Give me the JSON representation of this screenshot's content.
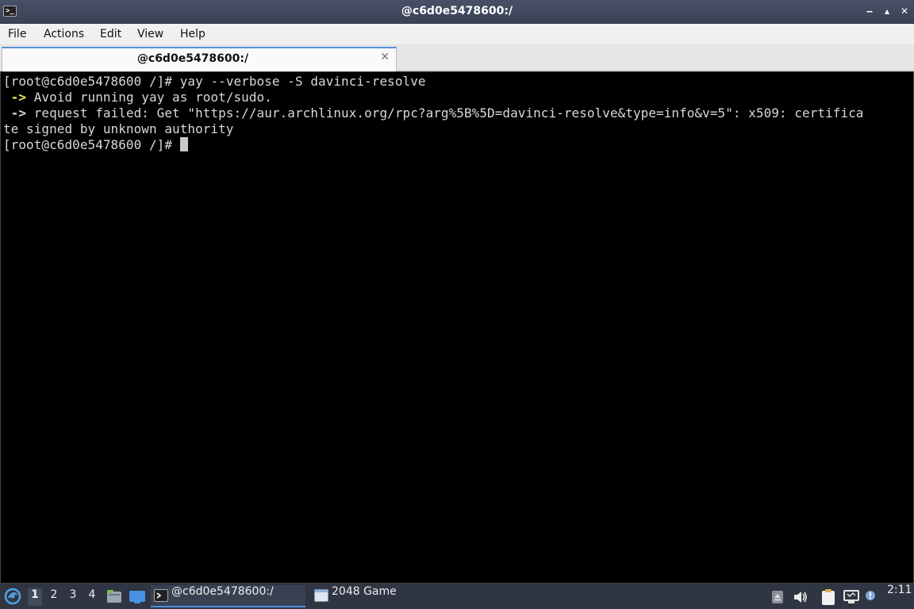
{
  "window": {
    "title": "@c6d0e5478600:/",
    "app_icon": "terminal-icon",
    "buttons": {
      "minimize": "‒",
      "maximize": "▴",
      "close": "✕"
    }
  },
  "menubar": {
    "items": [
      "File",
      "Actions",
      "Edit",
      "View",
      "Help"
    ]
  },
  "tab": {
    "label": "@c6d0e5478600:/",
    "close": "✕"
  },
  "terminal": {
    "lines": [
      {
        "prompt": "[root@c6d0e5478600 /]# ",
        "text": "yay --verbose -S davinci-resolve"
      },
      {
        "arrow": " ->",
        "text": " Avoid running yay as root/sudo."
      },
      {
        "arrow": " ->",
        "text": " request failed: Get \"https://aur.archlinux.org/rpc?arg%5B%5D=davinci-resolve&type=info&v=5\": x509: certifica"
      },
      {
        "text": "te signed by unknown authority"
      },
      {
        "prompt": "[root@c6d0e5478600 /]# ",
        "text": ""
      }
    ]
  },
  "taskbar": {
    "start_icon": "lxqt-start-icon",
    "desktops": [
      "1",
      "2",
      "3",
      "4"
    ],
    "active_desktop": "1",
    "quicklaunch": [
      "file-manager-icon",
      "desktop-icon"
    ],
    "tasks": [
      {
        "icon": "terminal-icon",
        "label": "@c6d0e5478600:/",
        "active": true
      },
      {
        "icon": "window-icon",
        "label": "2048 Game",
        "active": false
      }
    ],
    "tray": [
      "eject-icon",
      "volume-icon",
      "clipboard-icon",
      "network-icon",
      "notification-icon"
    ],
    "clock": "2:11"
  },
  "colors": {
    "titlebar": "#3f4759",
    "terminal_bg": "#000000",
    "terminal_fg": "#d8d8d8",
    "arrow_yellow": "#f3e45c",
    "taskbar": "#2f3542",
    "accent": "#4a90e2"
  }
}
